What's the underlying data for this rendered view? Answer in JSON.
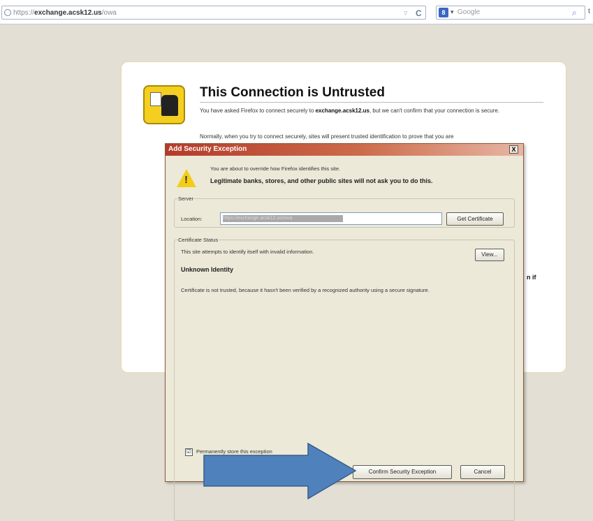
{
  "browser": {
    "url_prefix": "https://",
    "url_host": "exchange.acsk12.us",
    "url_path": "/owa",
    "search_engine_glyph": "8",
    "search_placeholder": "Google",
    "edge_char": "t"
  },
  "page": {
    "headline": "This Connection is Untrusted",
    "intro_before": "You have asked Firefox to connect securely to",
    "intro_host": "exchange.acsk12.us",
    "intro_after": ", but we can't confirm that your connection is secure.",
    "intro2": "Normally, when you try to connect securely, sites will present trusted identification to prove that you are",
    "side_fragment": "n if"
  },
  "dialog": {
    "title": "Add Security Exception",
    "close_label": "X",
    "warning_line1": "You are about to override how Firefox identifies this site.",
    "warning_line2": "Legitimate banks, stores, and other public sites will not ask you to do this.",
    "server_legend": "Server",
    "location_label": "Location:",
    "location_value": "https://exchange.acsk12.us/owa",
    "get_certificate": "Get Certificate",
    "status_legend": "Certificate Status",
    "status_line": "This site attempts to identify itself with invalid information.",
    "view_button": "View...",
    "unknown_identity": "Unknown Identity",
    "reason": "Certificate is not trusted, because it hasn't been verified by a recognized authority using a secure signature.",
    "permanent_checked": "☑",
    "permanent_label": "Permanently store this exception",
    "confirm_button": "Confirm Security Exception",
    "cancel_button": "Cancel"
  },
  "colors": {
    "arrow_fill": "#4f81bd",
    "arrow_stroke": "#385d8a",
    "title_gradient_start": "#b43b2a"
  }
}
